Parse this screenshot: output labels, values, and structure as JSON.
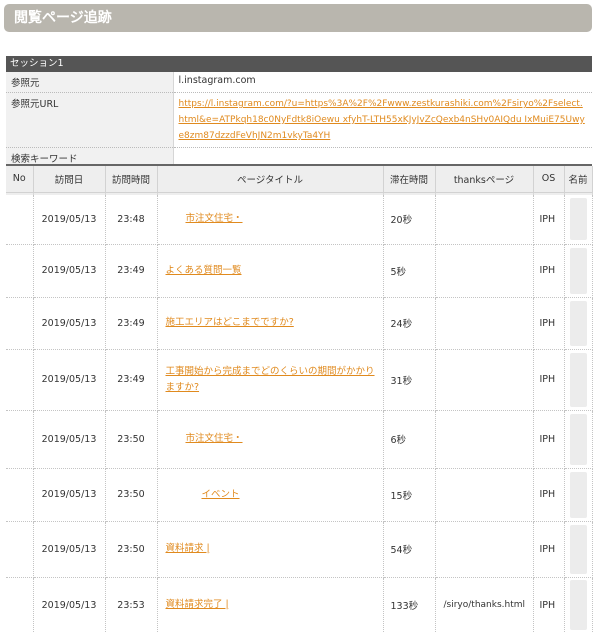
{
  "page": {
    "title": "閲覧ページ追跡"
  },
  "session": {
    "label": "セッション1",
    "rows": [
      {
        "label": "参照元",
        "value": "l.instagram.com"
      },
      {
        "label": "参照元URL",
        "value": "https://l.instagram.com/?u=https%3A%2F%2Fwww.zestkurashiki.com%2Fsiryo%2Fselect.html&e=ATPkqh18c0NyFdtk8iOewu xfyhT-LTH55xKJyJvZcQexb4nSHv0AIQdu IxMuiE75Uwye8zm87dzzdFeVhJN2m1vkyTa4YH"
      },
      {
        "label": "検索キーワード",
        "value": ""
      }
    ]
  },
  "table": {
    "headers": [
      "No",
      "訪問日",
      "訪問時間",
      "ページタイトル",
      "滞在時間",
      "thanksページ",
      "OS",
      "名前"
    ],
    "rows": [
      {
        "no": "",
        "date": "2019/05/13",
        "time": "23:48",
        "title": "市注文住宅・",
        "stay": "20秒",
        "thanks": "",
        "os": "IPH"
      },
      {
        "no": "",
        "date": "2019/05/13",
        "time": "23:49",
        "title": "よくある質問一覧",
        "stay": "5秒",
        "thanks": "",
        "os": "IPH"
      },
      {
        "no": "",
        "date": "2019/05/13",
        "time": "23:49",
        "title": "施工エリアはどこまでですか?",
        "stay": "24秒",
        "thanks": "",
        "os": "IPH"
      },
      {
        "no": "",
        "date": "2019/05/13",
        "time": "23:49",
        "title": "工事開始から完成までどのくらいの期間がかかりますか?",
        "stay": "31秒",
        "thanks": "",
        "os": "IPH"
      },
      {
        "no": "",
        "date": "2019/05/13",
        "time": "23:50",
        "title": "市注文住宅・",
        "stay": "6秒",
        "thanks": "",
        "os": "IPH"
      },
      {
        "no": "",
        "date": "2019/05/13",
        "time": "23:50",
        "title": "イベント",
        "stay": "15秒",
        "thanks": "",
        "os": "IPH"
      },
      {
        "no": "",
        "date": "2019/05/13",
        "time": "23:50",
        "title": "資料請求 |",
        "stay": "54秒",
        "thanks": "",
        "os": "IPH"
      },
      {
        "no": "",
        "date": "2019/05/13",
        "time": "23:53",
        "title": "資料請求完了 |",
        "stay": "133秒",
        "thanks": "/siryo/thanks.html",
        "os": "IPH"
      }
    ]
  },
  "colors": {
    "link": "#e08a1e",
    "header_bar": "#b9b6ae",
    "session_bar": "#555555"
  }
}
